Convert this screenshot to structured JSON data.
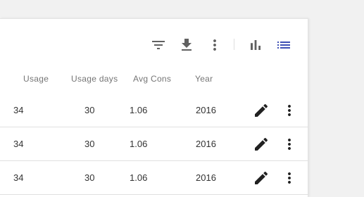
{
  "toolbar": {
    "icons": [
      "filter-icon",
      "download-icon",
      "more-vert-icon",
      "bar-chart-icon",
      "list-view-icon"
    ],
    "active_view": "list-view-icon",
    "active_color": "#3f51b5",
    "icon_color": "#616161"
  },
  "table": {
    "columns": [
      "Usage",
      "Usage days",
      "Avg Cons",
      "Year"
    ],
    "rows": [
      {
        "usage": "34",
        "usage_days": "30",
        "avg_cons": "1.06",
        "year": "2016"
      },
      {
        "usage": "34",
        "usage_days": "30",
        "avg_cons": "1.06",
        "year": "2016"
      },
      {
        "usage": "34",
        "usage_days": "30",
        "avg_cons": "1.06",
        "year": "2016"
      }
    ],
    "row_actions": [
      "edit-icon",
      "more-vert-icon"
    ]
  }
}
